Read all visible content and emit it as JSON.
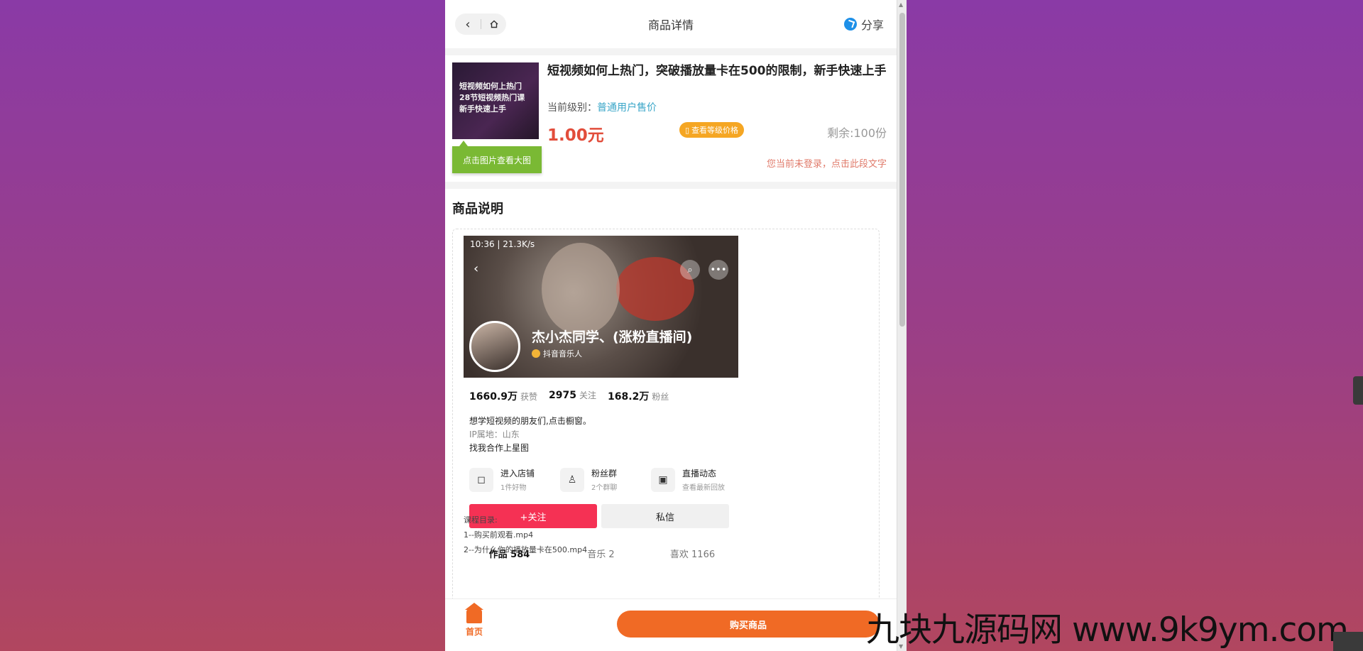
{
  "header": {
    "title": "商品详情",
    "share_label": "分享"
  },
  "product": {
    "thumb_text": [
      "短视频如何上热门",
      "28节短视频热门课",
      "新手快速上手"
    ],
    "thumb_button": "点击图片查看大图",
    "title": "短视频如何上热门，突破播放量卡在500的限制，新手快速上手",
    "level_label": "当前级别：",
    "level_value": "普通用户售价",
    "price": "1.00元",
    "level_price_button": "查看等级价格",
    "stock": "剩余:100份",
    "login_tip": "您当前未登录，点击此段文字"
  },
  "description": {
    "heading": "商品说明",
    "screenshot": {
      "status": "10:36 | 21.3K/s",
      "nickname": "杰小杰同学、(涨粉直播间)",
      "badge": "抖音音乐人",
      "stats": [
        {
          "num": "1660.9万",
          "label": "获赞"
        },
        {
          "num": "2975",
          "label": "关注"
        },
        {
          "num": "168.2万",
          "label": "粉丝"
        }
      ],
      "bio_line1": "想学短视频的朋友们,点击橱窗。",
      "bio_ip": "IP属地：山东",
      "bio_line3": "找我合作上星图",
      "features": [
        {
          "title": "进入店铺",
          "sub": "1件好物"
        },
        {
          "title": "粉丝群",
          "sub": "2个群聊"
        },
        {
          "title": "直播动态",
          "sub": "查看最新回放"
        }
      ],
      "follow_label": "+关注",
      "dm_label": "私信",
      "tabs": [
        "作品 584",
        "音乐 2",
        "喜欢 1166"
      ]
    },
    "catalog": [
      "课程目录:",
      "1--购买前观看.mp4",
      "2--为什么你的播放量卡在500.mp4"
    ]
  },
  "bottombar": {
    "home_label": "首页",
    "buy_label": "购买商品"
  },
  "watermark": "九块九源码网 www.9k9ym.com",
  "colors": {
    "accent": "#f06a25",
    "price": "#e24d3b",
    "level": "#3aa6c8",
    "follow": "#f53154"
  }
}
